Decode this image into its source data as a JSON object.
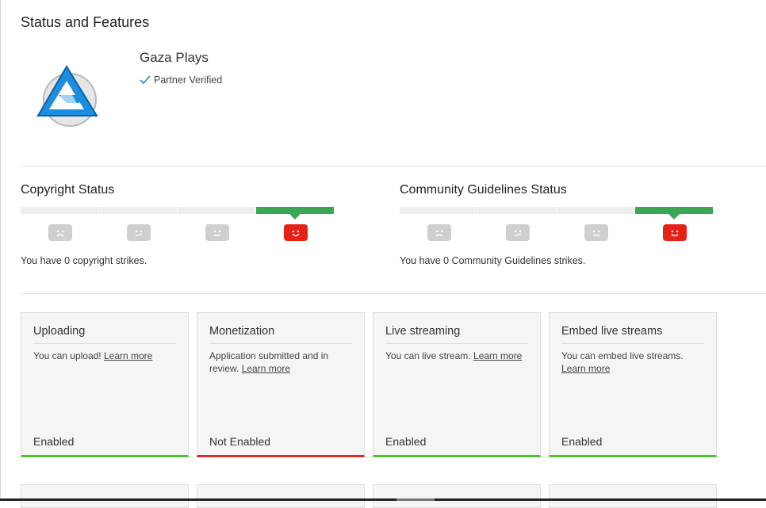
{
  "page": {
    "title": "Status and Features"
  },
  "channel": {
    "name": "Gaza Plays",
    "verified_label": "Partner Verified"
  },
  "colors": {
    "ok": "#3aa757",
    "enabled": "#4fc32c",
    "disabled": "#d62c28",
    "face_good": "#e62117"
  },
  "copyright": {
    "title": "Copyright Status",
    "strikes_text": "You have 0 copyright strikes.",
    "faces": [
      "sad-face-icon",
      "unsure-face-icon",
      "neutral-face-icon",
      "happy-face-icon"
    ]
  },
  "community": {
    "title": "Community Guidelines Status",
    "strikes_text": "You have 0 Community Guidelines strikes.",
    "faces": [
      "sad-face-icon",
      "unsure-face-icon",
      "neutral-face-icon",
      "happy-face-icon"
    ]
  },
  "features": [
    {
      "title": "Uploading",
      "desc": "You can upload!",
      "link": "Learn more",
      "status": "Enabled"
    },
    {
      "title": "Monetization",
      "desc": "Application submitted and in review.",
      "link": "Learn more",
      "status": "Not Enabled"
    },
    {
      "title": "Live streaming",
      "desc": "You can live stream.",
      "link": "Learn more",
      "status": "Enabled"
    },
    {
      "title": "Embed live streams",
      "desc": "You can embed live streams.",
      "link": "Learn more",
      "status": "Enabled"
    }
  ]
}
